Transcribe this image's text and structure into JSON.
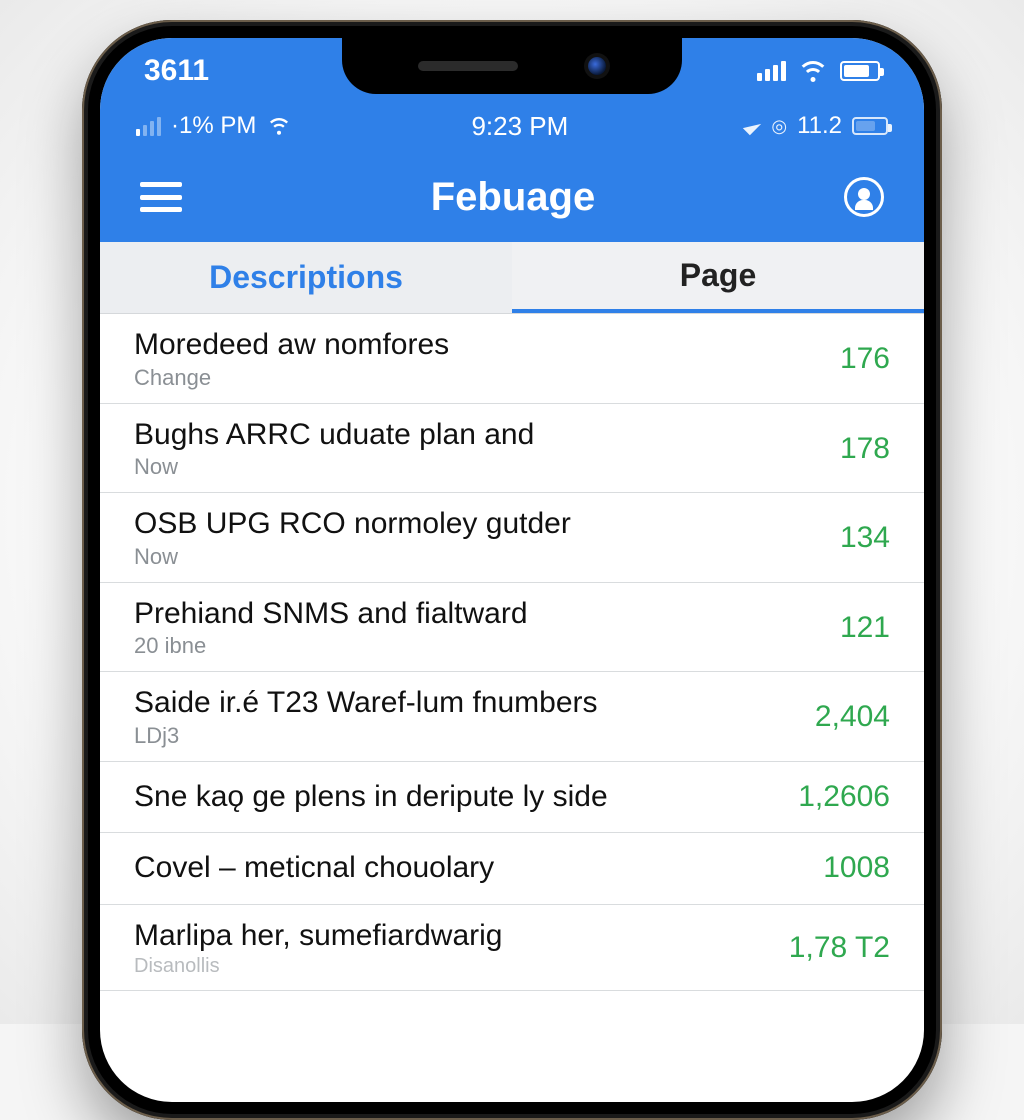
{
  "status1": {
    "left": "3611"
  },
  "status2": {
    "left_pct": "·1% PM",
    "time": "9:23 PM",
    "right": "11.2"
  },
  "header": {
    "title": "Febuage"
  },
  "tabs": [
    {
      "label": "Descriptions",
      "active": true
    },
    {
      "label": "Page",
      "active": false
    }
  ],
  "rows": [
    {
      "title": "Moredeed aw nomfores",
      "sub": "Change",
      "page": "176"
    },
    {
      "title": "Bughs ARRC uduate plan and",
      "sub": "Now",
      "page": "178"
    },
    {
      "title": "OSB UPG RCO normoley gutder",
      "sub": "Now",
      "page": "134"
    },
    {
      "title": "Prehiand SNMS and fialtward",
      "sub": "20 ibne",
      "page": "121"
    },
    {
      "title": "Saide ir.é T23 Waref-lum fnumbers",
      "sub": "LDj3",
      "page": "2,404"
    },
    {
      "title": "Sne kaǫ ge plens in deripute ly side",
      "sub": "",
      "page": "1,2606"
    },
    {
      "title": "Covel – meticnal chouolary",
      "sub": "",
      "page": "1008"
    },
    {
      "title": "Marlipa her, sumefiardwarig",
      "sub": "Disanollis",
      "page": "1,78 T2"
    }
  ]
}
